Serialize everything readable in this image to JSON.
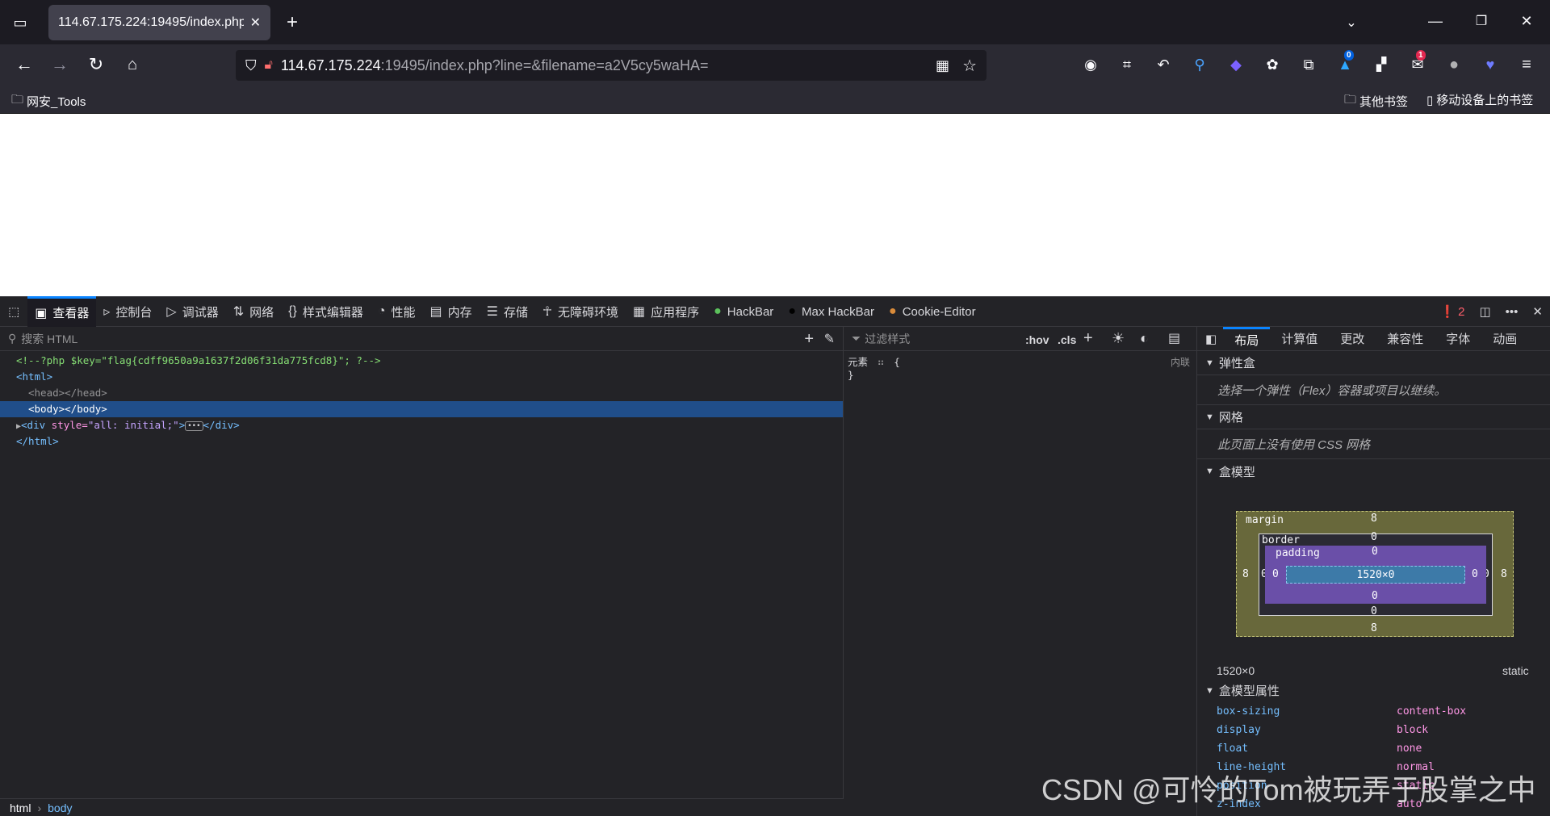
{
  "tab": {
    "title": "114.67.175.224:19495/index.php"
  },
  "url": {
    "host": "114.67.175.224",
    "rest": ":19495/index.php?line=&filename=a2V5cy5waHA="
  },
  "bookmarks": {
    "left": "网安_Tools",
    "other": "其他书签",
    "mobile": "移动设备上的书签"
  },
  "ext_badges": {
    "blue": "0",
    "red": "1"
  },
  "devtools": {
    "tabs": [
      "查看器",
      "控制台",
      "调试器",
      "网络",
      "样式编辑器",
      "性能",
      "内存",
      "存储",
      "无障碍环境",
      "应用程序",
      "HackBar",
      "Max HackBar",
      "Cookie-Editor"
    ],
    "error_count": "2",
    "search_placeholder": "搜索 HTML",
    "markup": {
      "comment": "<!--?php $key=\"flag{cdff9650a9a1637f2d06f31da775fcd8}\"; ?-->",
      "html_open": "<html>",
      "head": "<head></head>",
      "body": "<body></body>",
      "div_open": "<div ",
      "div_attr": "style=",
      "div_val": "\"all: initial;\"",
      "div_close": "></div>",
      "html_close": "</html>"
    },
    "rules": {
      "filter": "过滤样式",
      "hov": ":hov",
      "cls": ".cls",
      "element": "元素",
      "brace_open": "{",
      "brace_close": "}",
      "inline": "内联"
    },
    "sidebar_tabs": [
      "布局",
      "计算值",
      "更改",
      "兼容性",
      "字体",
      "动画"
    ],
    "layout": {
      "flex_head": "弹性盒",
      "flex_body": "选择一个弹性（Flex）容器或项目以继续。",
      "grid_head": "网格",
      "grid_body": "此页面上没有使用 CSS 网格",
      "box_head": "盒模型",
      "box": {
        "margin_label": "margin",
        "border_label": "border",
        "padding_label": "padding",
        "margin": "8",
        "border": "0",
        "padding": "0",
        "content": "1520×0"
      },
      "size": "1520×0",
      "position": "static",
      "props_head": "盒模型属性",
      "props": [
        {
          "name": "box-sizing",
          "value": "content-box"
        },
        {
          "name": "display",
          "value": "block"
        },
        {
          "name": "float",
          "value": "none"
        },
        {
          "name": "line-height",
          "value": "normal"
        },
        {
          "name": "position",
          "value": "static"
        },
        {
          "name": "z-index",
          "value": "auto"
        }
      ]
    },
    "breadcrumb": {
      "html": "html",
      "body": "body"
    }
  },
  "watermark": "CSDN @可怜的Tom被玩弄于股掌之中"
}
